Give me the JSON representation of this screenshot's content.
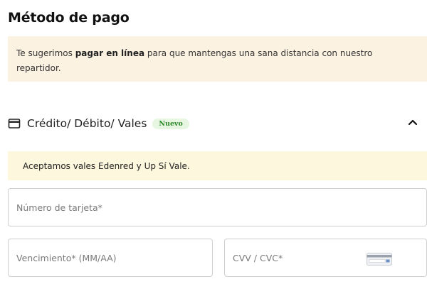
{
  "page": {
    "title": "Método de pago"
  },
  "notice": {
    "prefix": "Te sugerimos ",
    "highlight": "pagar en línea",
    "suffix": " para que mantengas una sana distancia con nuestro repartidor."
  },
  "payment_section": {
    "label": "Crédito/ Débito/ Vales",
    "badge": "Nuevo",
    "icon": "credit-card-icon",
    "expanded": true,
    "vales_notice": "Aceptamos vales Edenred y Up Sí Vale."
  },
  "fields": {
    "card_number": {
      "placeholder": "Número de tarjeta*",
      "value": ""
    },
    "expiry": {
      "placeholder": "Vencimiento* (MM/AA)",
      "value": ""
    },
    "cvv": {
      "placeholder": "CVV / CVC*",
      "value": ""
    }
  },
  "colors": {
    "notice_bg": "#fcf2e2",
    "vales_bg": "#fdf7dd",
    "badge_bg": "#e6f6e0",
    "badge_text": "#2c8a2c",
    "field_border": "#cfcfcf"
  }
}
